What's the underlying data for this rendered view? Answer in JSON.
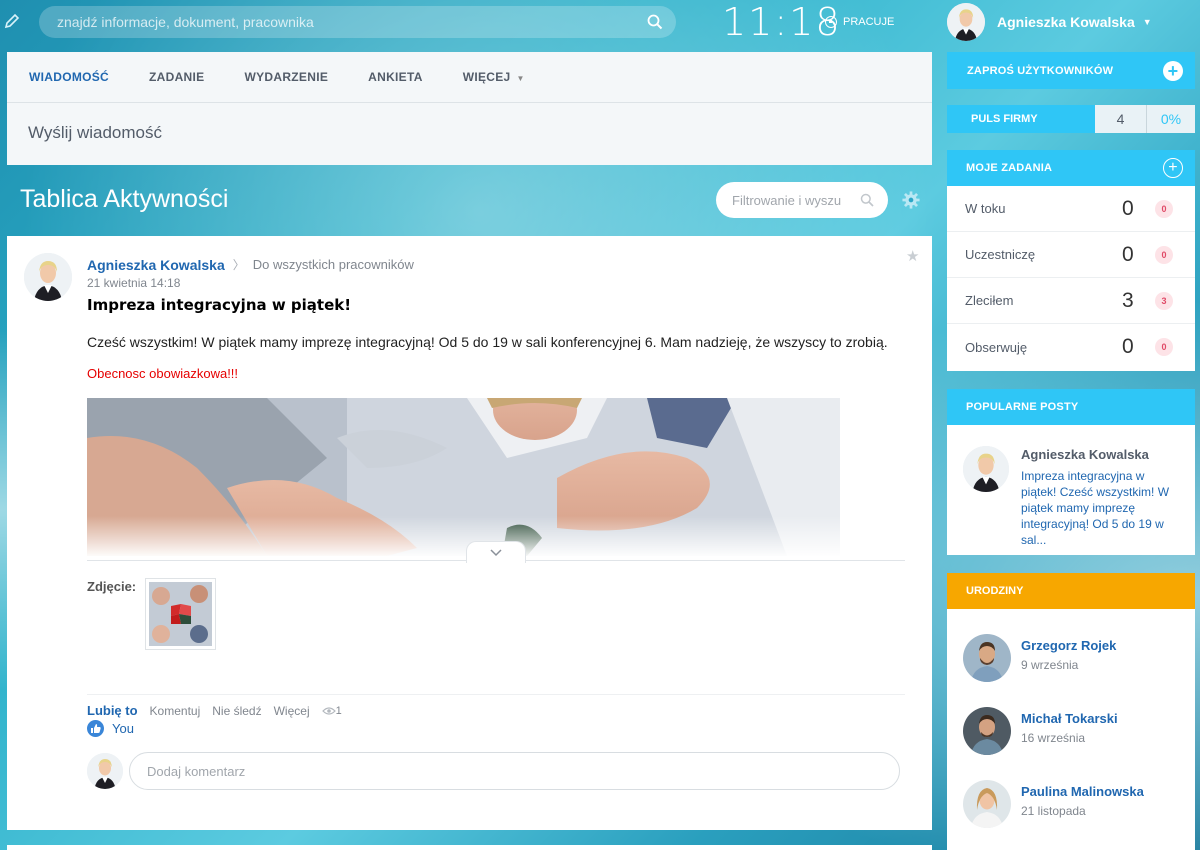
{
  "topbar": {
    "search_placeholder": "znajdź informacje, dokument, pracownika",
    "time": "11:18",
    "status": "PRACUJE",
    "user_name": "Agnieszka Kowalska"
  },
  "composer": {
    "tabs": [
      {
        "label": "WIADOMOŚĆ",
        "active": true
      },
      {
        "label": "ZADANIE"
      },
      {
        "label": "WYDARZENIE"
      },
      {
        "label": "ANKIETA"
      },
      {
        "label": "WIĘCEJ"
      }
    ],
    "send_label": "Wyślij wiadomość"
  },
  "feed": {
    "title": "Tablica Aktywności",
    "filter_placeholder": "Filtrowanie i wyszu"
  },
  "post": {
    "author": "Agnieszka Kowalska",
    "destination": "Do wszystkich pracowników",
    "date": "21 kwietnia 14:18",
    "headline": "Impreza integracyjna w piątek!",
    "body": "Cześć wszystkim! W piątek mamy imprezę integracyjną! Od 5 do 19 w sali konferencyjnej 6. Mam nadzieję, że wszyscy to zrobią.",
    "highlight": "Obecnosc obowiazkowa!!!",
    "photo_label": "Zdjęcie:",
    "actions": {
      "like": "Lubię to",
      "comment": "Komentuj",
      "unfollow": "Nie śledź",
      "more": "Więcej",
      "views": "1"
    },
    "liked_by": "You",
    "comment_placeholder": "Dodaj komentarz"
  },
  "sidebar": {
    "invite": "ZAPROŚ UŻYTKOWNIKÓW",
    "pulse": {
      "label": "PULS FIRMY",
      "count": "4",
      "percent": "0%"
    },
    "tasks": {
      "title": "MOJE ZADANIA",
      "rows": [
        {
          "label": "W toku",
          "count": "0",
          "badge": "0"
        },
        {
          "label": "Uczestniczę",
          "count": "0",
          "badge": "0"
        },
        {
          "label": "Zleciłem",
          "count": "3",
          "badge": "3"
        },
        {
          "label": "Obserwuję",
          "count": "0",
          "badge": "0"
        }
      ]
    },
    "popular": {
      "title": "POPULARNE POSTY",
      "author": "Agnieszka Kowalska",
      "text": "Impreza integracyjna w piątek! Cześć wszystkim! W piątek mamy imprezę integracyjną! Od 5 do 19 w sal..."
    },
    "birthdays": {
      "title": "URODZINY",
      "people": [
        {
          "name": "Grzegorz Rojek",
          "date": "9 września"
        },
        {
          "name": "Michał Tokarski",
          "date": "16 września"
        },
        {
          "name": "Paulina Malinowska",
          "date": "21 listopada"
        }
      ]
    }
  },
  "colors": {
    "accent": "#2fc6f6",
    "link": "#2067b0",
    "birthday": "#f7a700",
    "highlight_red": "#e60000"
  }
}
